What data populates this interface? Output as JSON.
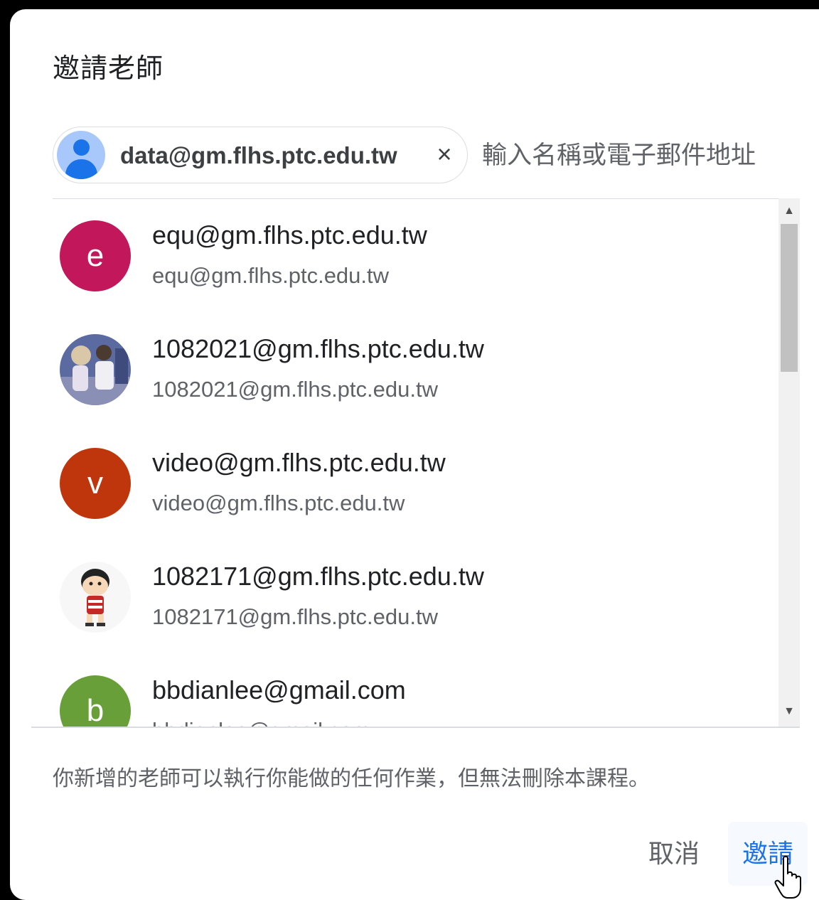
{
  "dialog": {
    "title": "邀請老師",
    "selected_chip": {
      "email": "data@gm.flhs.ptc.edu.tw",
      "remove_icon": "×"
    },
    "input_placeholder": "輸入名稱或電子郵件地址",
    "suggestions": [
      {
        "avatar_letter": "e",
        "avatar_color": "#c2185b",
        "name": "equ@gm.flhs.ptc.edu.tw",
        "email": "equ@gm.flhs.ptc.edu.tw"
      },
      {
        "avatar_letter": "",
        "avatar_color": "#6d7ba8",
        "avatar_type": "photo",
        "name": "1082021@gm.flhs.ptc.edu.tw",
        "email": "1082021@gm.flhs.ptc.edu.tw"
      },
      {
        "avatar_letter": "v",
        "avatar_color": "#bf360c",
        "name": "video@gm.flhs.ptc.edu.tw",
        "email": "video@gm.flhs.ptc.edu.tw"
      },
      {
        "avatar_letter": "",
        "avatar_color": "#ffffff",
        "avatar_type": "cartoon",
        "name": "1082171@gm.flhs.ptc.edu.tw",
        "email": "1082171@gm.flhs.ptc.edu.tw"
      },
      {
        "avatar_letter": "b",
        "avatar_color": "#689f38",
        "name": "bbdianlee@gmail.com",
        "email": "bbdianlee@gmail.com"
      }
    ],
    "note": "你新增的老師可以執行你能做的任何作業，但無法刪除本課程。",
    "buttons": {
      "cancel": "取消",
      "invite": "邀請"
    }
  }
}
